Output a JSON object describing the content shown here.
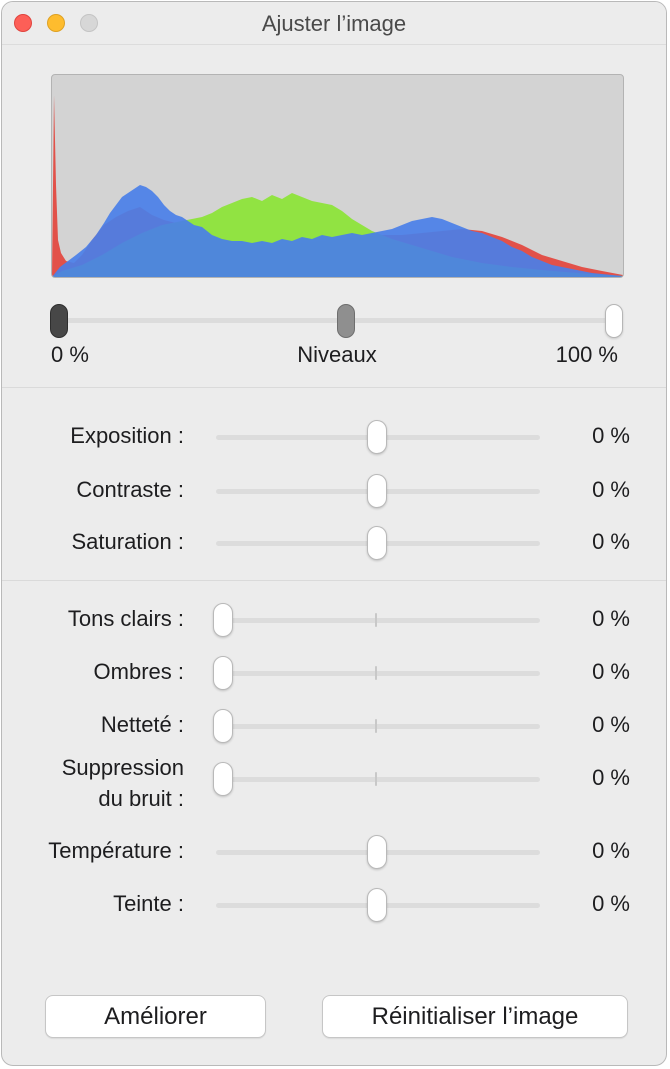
{
  "window": {
    "title": "Ajuster l’image"
  },
  "levels": {
    "min_label": "0 %",
    "center_label": "Niveaux",
    "max_label": "100 %",
    "black_point": 0.0,
    "midtone": 0.5,
    "white_point": 1.0
  },
  "histogram": {
    "colors": {
      "red": "#e3423a",
      "green": "#8de43a",
      "blue": "#4a7fe8",
      "background": "#d3d3d3"
    }
  },
  "adjustments_main": [
    {
      "label": "Exposition :",
      "value": "0 %",
      "position": 0.5
    },
    {
      "label": "Contraste :",
      "value": "0 %",
      "position": 0.5
    },
    {
      "label": "Saturation :",
      "value": "0 %",
      "position": 0.5
    }
  ],
  "adjustments_detail": [
    {
      "label": "Tons clairs :",
      "value": "0 %",
      "position": 0.0
    },
    {
      "label": "Ombres :",
      "value": "0 %",
      "position": 0.0
    },
    {
      "label": "Netteté :",
      "value": "0 %",
      "position": 0.0
    },
    {
      "label_line1": "Suppression",
      "label_line2": "du bruit :",
      "value": "0 %",
      "position": 0.0
    },
    {
      "label": "Température :",
      "value": "0 %",
      "position": 0.5
    },
    {
      "label": "Teinte :",
      "value": "0 %",
      "position": 0.5
    }
  ],
  "buttons": {
    "enhance": "Améliorer",
    "reset": "Réinitialiser l’image"
  }
}
